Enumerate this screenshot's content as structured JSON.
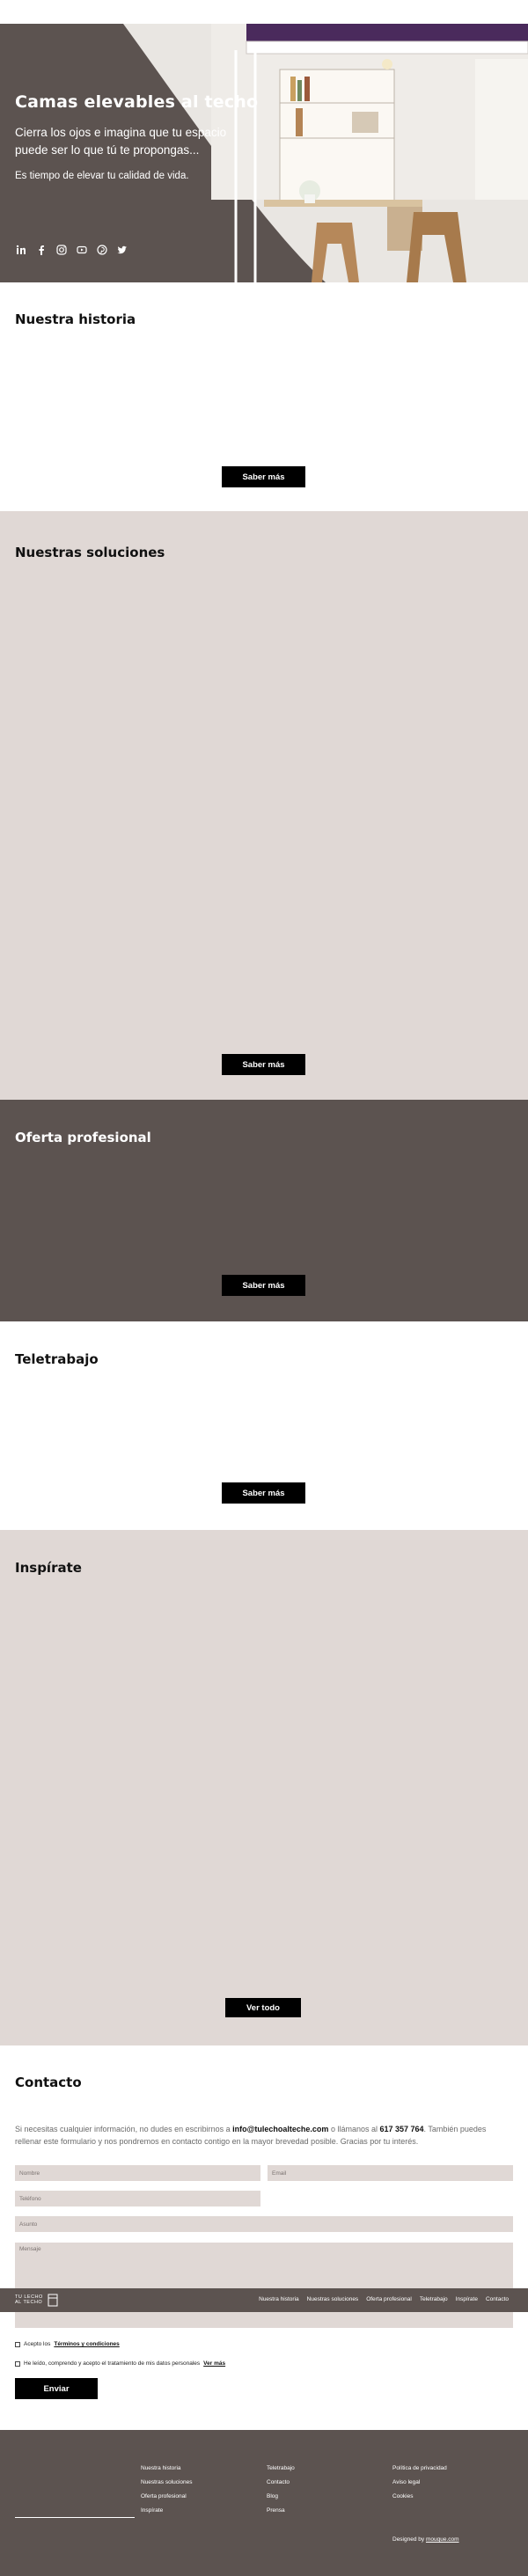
{
  "hero": {
    "title": "Camas elevables al techo",
    "subtitle": "Cierra los ojos e imagina que tu espacio puede ser lo que tú te propongas...",
    "tagline": "Es tiempo de elevar tu calidad de vida.",
    "socials": [
      "linkedin-icon",
      "facebook-icon",
      "instagram-icon",
      "youtube-icon",
      "pinterest-icon",
      "twitter-icon"
    ]
  },
  "historia": {
    "title": "Nuestra historia",
    "button": "Saber más"
  },
  "soluciones": {
    "title": "Nuestras soluciones",
    "button": "Saber más"
  },
  "oferta": {
    "title": "Oferta profesional",
    "button": "Saber más"
  },
  "teletrabajo": {
    "title": "Teletrabajo",
    "button": "Saber más"
  },
  "inspirate": {
    "title": "Inspírate",
    "button": "Ver todo"
  },
  "contacto": {
    "title": "Contacto",
    "intro_1": "Si necesitas cualquier información, no dudes en escribirnos a ",
    "email": "info@tulechoalteche.com",
    "intro_2": " o llámanos al ",
    "phone": "617 357 764",
    "intro_3": ". También puedes rellenar este formulario y nos pondremos en contacto contigo en la mayor brevedad posible. Gracias por tu interés.",
    "placeholders": {
      "nombre": "Nombre",
      "email": "Email",
      "telefono": "Teléfono",
      "asunto": "Asunto",
      "mensaje": "Mensaje"
    },
    "accept_prefix": "Acepto los ",
    "accept_link": "Términos y condiciones",
    "privacy_text": "He leído, comprendo y acepto el tratamiento de mis datos personales ",
    "privacy_link": "Ver más",
    "submit": "Enviar"
  },
  "navbar": {
    "logo_line1": "TU LECHO",
    "logo_line2": "AL TECHO",
    "links": [
      "Nuestra historia",
      "Nuestras soluciones",
      "Oferta profesional",
      "Teletrabajo",
      "Inspírate",
      "Contacto"
    ]
  },
  "footer": {
    "col1": [
      "Nuestra historia",
      "Nuestras soluciones",
      "Oferta profesional",
      "Inspírate"
    ],
    "col2": [
      "Teletrabajo",
      "Contacto",
      "Blog",
      "Prensa"
    ],
    "col3": [
      "Política de privacidad",
      "Aviso legal",
      "Cookies"
    ],
    "designed_prefix": "Designed by ",
    "designed_link": "mouque.com"
  },
  "colors": {
    "dark": "#5c5350",
    "light": "#e0d8d5",
    "button": "#000000"
  }
}
